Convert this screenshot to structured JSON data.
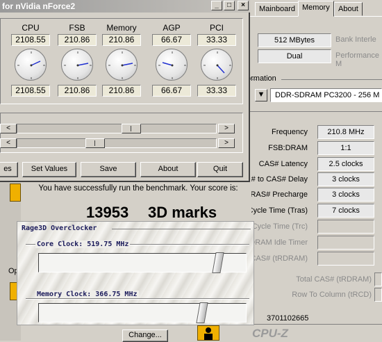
{
  "cpuz": {
    "tabs": [
      "Mainboard",
      "Memory",
      "About"
    ],
    "active_tab": "Memory",
    "memory_size": "512 MBytes",
    "bank_interleave_label": "Bank Interle",
    "channels": "Dual",
    "performance_mode_label": "Performance M",
    "spd_section_label": "ormation",
    "module": "DDR-SDRAM PC3200 - 256 M",
    "timings": [
      {
        "label": "Frequency",
        "value": "210.8 MHz"
      },
      {
        "label": "FSB:DRAM",
        "value": "1:1"
      },
      {
        "label": "CAS# Latency",
        "value": "2.5 clocks"
      },
      {
        "label": "# to CAS# Delay",
        "value": "3 clocks"
      },
      {
        "label": "RAS# Precharge",
        "value": "3 clocks"
      },
      {
        "label": "Cycle Time (Tras)",
        "value": "7 clocks"
      },
      {
        "label": "Cycle Time (Trc)",
        "value": ""
      },
      {
        "label": "DRAM Idle Timer",
        "value": ""
      },
      {
        "label": "CAS# (tRDRAM)",
        "value": ""
      }
    ],
    "total_cas_label": "Total CAS# (tRDRAM)",
    "row_to_col_label": "Row To Column (tRCD)",
    "serial": "3701102665",
    "brand": "CPU-Z"
  },
  "benchmark": {
    "message": "You have successfully run the benchmark. Your score is:",
    "score": "13953",
    "unit": "3D marks",
    "side_label": "Op",
    "change_button": "Change..."
  },
  "rage3d": {
    "title": "Rage3D Overclocker",
    "core_label": "Core Clock: 519.75 MHz",
    "core_position": 0.88,
    "memory_label": "Memory Clock: 366.75 MHz",
    "memory_position": 0.8
  },
  "clockgen": {
    "title": "for nVidia nForce2",
    "title_buttons": [
      "_",
      "□",
      "×"
    ],
    "columns": [
      {
        "name": "CPU",
        "top": "2108.55",
        "bottom": "2108.55"
      },
      {
        "name": "FSB",
        "top": "210.86",
        "bottom": "210.86"
      },
      {
        "name": "Memory",
        "top": "210.86",
        "bottom": "210.86"
      },
      {
        "name": "AGP",
        "top": "66.67",
        "bottom": "66.67"
      },
      {
        "name": "PCI",
        "top": "33.33",
        "bottom": "33.33"
      }
    ],
    "slider1_position": 0.58,
    "slider2_position": 0.38,
    "buttons": [
      "es",
      "Set Values",
      "Save",
      "About",
      "Quit"
    ]
  }
}
